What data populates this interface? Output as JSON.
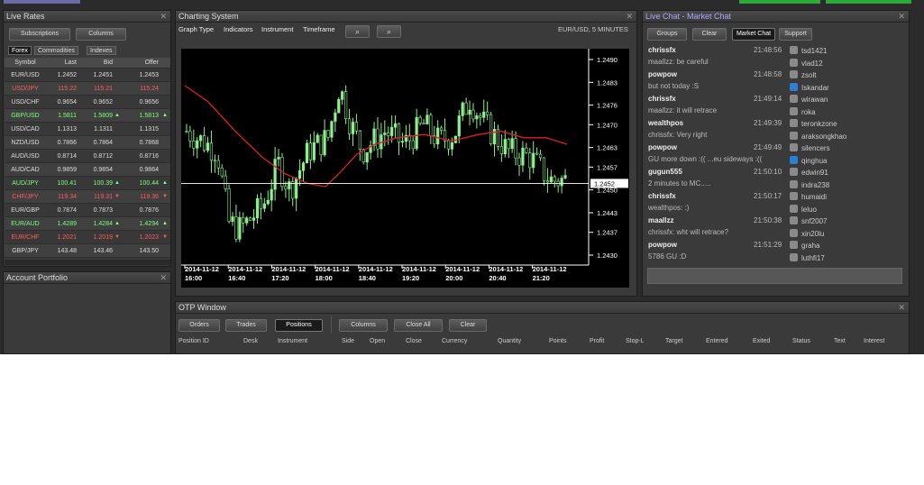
{
  "live_rates": {
    "title": "Live Rates",
    "subscriptions": "Subscriptions",
    "columns": "Columns",
    "tabs": [
      "Forex",
      "Commodities",
      "Indexes"
    ],
    "headers": [
      "Symbol",
      "Last",
      "Bid",
      "Offer"
    ],
    "rows": [
      {
        "symbol": "EUR/USD",
        "last": "1.2452",
        "bid": "1.2451",
        "offer": "1.2453",
        "color": "#dddddd",
        "dir": ""
      },
      {
        "symbol": "USD/JPY",
        "last": "115.22",
        "bid": "115.21",
        "offer": "115.24",
        "color": "#ff5c5c",
        "dir": ""
      },
      {
        "symbol": "USD/CHF",
        "last": "0.9654",
        "bid": "0.9652",
        "offer": "0.9656",
        "color": "#dddddd",
        "dir": ""
      },
      {
        "symbol": "GBP/USD",
        "last": "1.5811",
        "bid": "1.5809",
        "offer": "1.5813",
        "color": "#7dff7d",
        "dir": "up"
      },
      {
        "symbol": "USD/CAD",
        "last": "1.1313",
        "bid": "1.1311",
        "offer": "1.1315",
        "color": "#dddddd",
        "dir": ""
      },
      {
        "symbol": "NZD/USD",
        "last": "0.7866",
        "bid": "0.7864",
        "offer": "0.7868",
        "color": "#dddddd",
        "dir": ""
      },
      {
        "symbol": "AUD/USD",
        "last": "0.8714",
        "bid": "0.8712",
        "offer": "0.8716",
        "color": "#dddddd",
        "dir": ""
      },
      {
        "symbol": "AUD/CAD",
        "last": "0.9859",
        "bid": "0.9854",
        "offer": "0.9864",
        "color": "#dddddd",
        "dir": ""
      },
      {
        "symbol": "AUD/JPY",
        "last": "100.41",
        "bid": "100.39",
        "offer": "100.44",
        "color": "#7dff7d",
        "dir": "up"
      },
      {
        "symbol": "CHF/JPY",
        "last": "119.34",
        "bid": "119.31",
        "offer": "119.36",
        "color": "#ff5c5c",
        "dir": "down"
      },
      {
        "symbol": "EUR/GBP",
        "last": "0.7874",
        "bid": "0.7873",
        "offer": "0.7876",
        "color": "#dddddd",
        "dir": ""
      },
      {
        "symbol": "EUR/AUD",
        "last": "1.4289",
        "bid": "1.4284",
        "offer": "1.4294",
        "color": "#7dff7d",
        "dir": "up"
      },
      {
        "symbol": "EUR/CHF",
        "last": "1.2021",
        "bid": "1.2019",
        "offer": "1.2023",
        "color": "#ff5c5c",
        "dir": "down"
      },
      {
        "symbol": "GBP/JPY",
        "last": "143.48",
        "bid": "143.46",
        "offer": "143.50",
        "color": "#dddddd",
        "dir": ""
      }
    ]
  },
  "account_portfolio": {
    "title": "Account Portfolio"
  },
  "charting": {
    "title": "Charting System",
    "toolbar": [
      "Graph Type",
      "Indicators",
      "Instrument",
      "Timeframe"
    ],
    "instrument_label": "EUR/USD, 5 MINUTES",
    "current_price": "1.2452"
  },
  "chart_data": {
    "type": "candlestick",
    "instrument": "EUR/USD",
    "timeframe": "5 MINUTES",
    "y_ticks": [
      "1.2490",
      "1.2483",
      "1.2476",
      "1.2470",
      "1.2463",
      "1.2457",
      "1.2450",
      "1.2443",
      "1.2437",
      "1.2430"
    ],
    "ylim": [
      1.2425,
      1.2495
    ],
    "x_ticks": [
      {
        "date": "2014-11-12",
        "time": "16:00"
      },
      {
        "date": "2014-11-12",
        "time": "16:40"
      },
      {
        "date": "2014-11-12",
        "time": "17:20"
      },
      {
        "date": "2014-11-12",
        "time": "18:00"
      },
      {
        "date": "2014-11-12",
        "time": "18:40"
      },
      {
        "date": "2014-11-12",
        "time": "19:20"
      },
      {
        "date": "2014-11-12",
        "time": "20:00"
      },
      {
        "date": "2014-11-12",
        "time": "20:40"
      },
      {
        "date": "2014-11-12",
        "time": "21:20"
      }
    ],
    "current_price": 1.2452,
    "moving_average": {
      "color": "#e01e1e"
    },
    "candle_color": "#8cf08c"
  },
  "chat": {
    "title": "Live Chat - Market Chat",
    "groups": "Groups",
    "clear": "Clear",
    "market_chat": "Market Chat",
    "support": "Support",
    "messages": [
      {
        "user": "chrissfx",
        "time": "21:48:56",
        "text": "maallzz: be careful"
      },
      {
        "user": "powpow",
        "time": "21:48:58",
        "text": "but not today :S"
      },
      {
        "user": "chrissfx",
        "time": "21:49:14",
        "text": "maallzz: it will retrace"
      },
      {
        "user": "wealthpos",
        "time": "21:49:39",
        "text": "chrissfx: Very right"
      },
      {
        "user": "powpow",
        "time": "21:49:49",
        "text": "GU more down :(( ...eu sideways :(("
      },
      {
        "user": "gugun555",
        "time": "21:50:10",
        "text": "2 minutes to MC....."
      },
      {
        "user": "chrissfx",
        "time": "21:50:17",
        "text": "wealthpos: :)"
      },
      {
        "user": "maallzz",
        "time": "21:50:38",
        "text": "chrissfx: wht will retrace?"
      },
      {
        "user": "powpow",
        "time": "21:51:29",
        "text": "5786 GU :D"
      }
    ],
    "online": [
      {
        "name": "tsd1421",
        "icon": "user-icon"
      },
      {
        "name": "vlad12",
        "icon": "user-icon"
      },
      {
        "name": "zsolt",
        "icon": "user-icon"
      },
      {
        "name": "Iskandar",
        "icon": "facebook-icon"
      },
      {
        "name": "wirawan",
        "icon": "user-icon"
      },
      {
        "name": "roka",
        "icon": "user-icon"
      },
      {
        "name": "teronkzone",
        "icon": "user-icon"
      },
      {
        "name": "araksongkhao",
        "icon": "user-icon"
      },
      {
        "name": "silencers",
        "icon": "user-icon"
      },
      {
        "name": "qinghua",
        "icon": "blue-user-icon"
      },
      {
        "name": "edwin91",
        "icon": "user-icon"
      },
      {
        "name": "indra238",
        "icon": "user-icon"
      },
      {
        "name": "humaidi",
        "icon": "user-icon"
      },
      {
        "name": "leluo",
        "icon": "user-icon"
      },
      {
        "name": "snf2007",
        "icon": "user-icon"
      },
      {
        "name": "xin20lu",
        "icon": "user-icon"
      },
      {
        "name": "graha",
        "icon": "user-icon"
      },
      {
        "name": "luthfi17",
        "icon": "user-icon"
      }
    ],
    "input_value": ""
  },
  "otp": {
    "title": "OTP Window",
    "buttons": [
      "Orders",
      "Trades",
      "Positions",
      "Columns",
      "Close All",
      "Clear"
    ],
    "headers": [
      "Position ID",
      "Desk",
      "Instrument",
      "Side",
      "Open",
      "Close",
      "Currency",
      "Quantity",
      "Points",
      "Profit",
      "Stop-L",
      "Target",
      "Entered",
      "Exited",
      "Status",
      "Text",
      "Interest"
    ]
  },
  "colors": {
    "up": "#7dff7d",
    "down": "#ff5c5c",
    "accent_purple": "#a9a9ff"
  }
}
